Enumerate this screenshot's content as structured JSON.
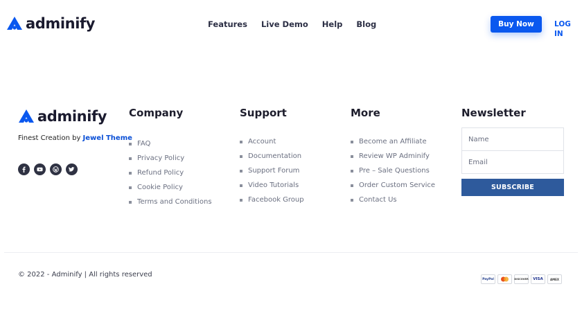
{
  "header": {
    "brand": "adminify",
    "nav": [
      {
        "label": "Features"
      },
      {
        "label": "Live Demo"
      },
      {
        "label": "Help"
      },
      {
        "label": "Blog"
      }
    ],
    "buy_label": "Buy Now",
    "login_label": "LOG IN"
  },
  "footer": {
    "brand": "adminify",
    "tagline_prefix": "Finest Creation by ",
    "tagline_brand": "Jewel Theme",
    "socials": [
      {
        "icon": "facebook-icon"
      },
      {
        "icon": "youtube-icon"
      },
      {
        "icon": "wordpress-icon"
      },
      {
        "icon": "twitter-icon"
      }
    ],
    "columns": {
      "company": {
        "title": "Company",
        "links": [
          "FAQ",
          "Privacy Policy",
          "Refund Policy",
          "Cookie Policy",
          "Terms and Conditions"
        ]
      },
      "support": {
        "title": "Support",
        "links": [
          "Account",
          "Documentation",
          "Support Forum",
          "Video Tutorials",
          "Facebook Group"
        ]
      },
      "more": {
        "title": "More",
        "links": [
          "Become an Affiliate",
          "Review WP Adminify",
          "Pre – Sale Questions",
          "Order Custom Service",
          "Contact Us"
        ]
      }
    },
    "newsletter": {
      "title": "Newsletter",
      "name_placeholder": "Name",
      "email_placeholder": "Email",
      "subscribe_label": "SUBSCRIBE"
    },
    "copyright": "© 2022 - Adminify | All rights reserved",
    "payments": [
      {
        "label": "PayPal",
        "color": "#1f3b8a"
      },
      {
        "label": "MC",
        "color": "#e8501c"
      },
      {
        "label": "DISCOVER",
        "color": "#333333"
      },
      {
        "label": "VISA",
        "color": "#1a2f8c"
      },
      {
        "label": "AMEX",
        "color": "#333333"
      }
    ]
  },
  "colors": {
    "accent": "#0a58ef",
    "subscribe_bg": "#2e5a9c",
    "social_bg": "#2f3243"
  }
}
